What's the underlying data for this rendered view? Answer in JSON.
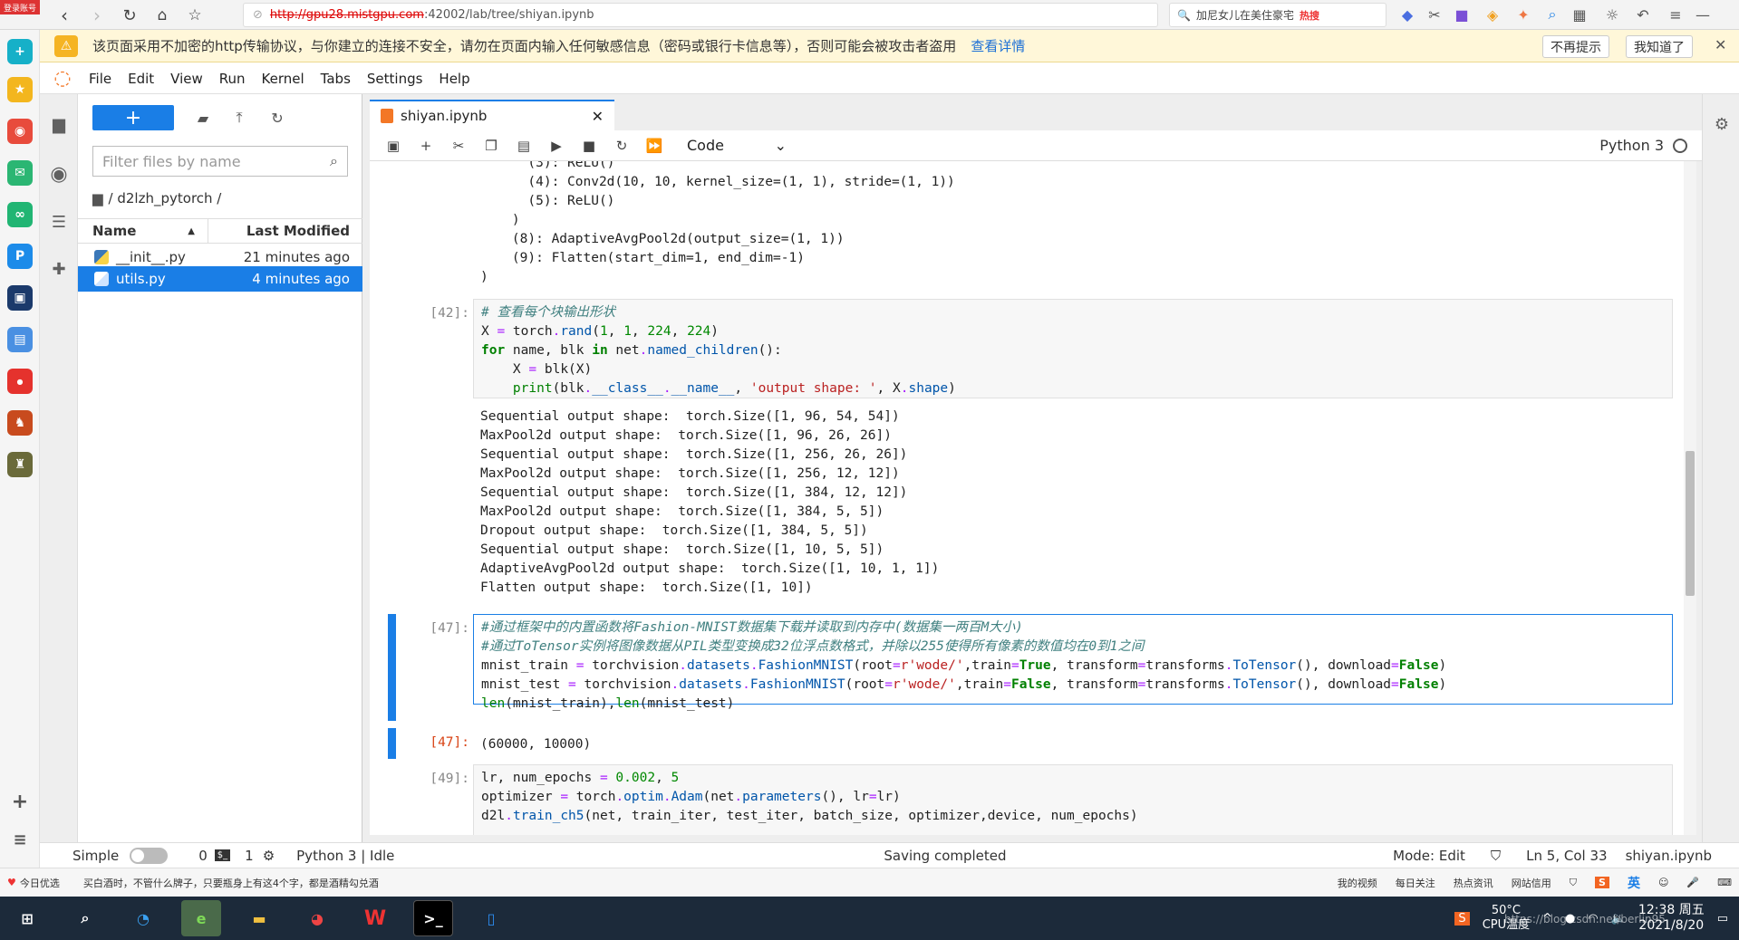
{
  "browser": {
    "login_badge": "登录账号",
    "url_host": "http://gpu28.mistgpu.com",
    "url_rest": ":42002/lab/tree/shiyan.ipynb",
    "search_text": "加尼女儿在美住豪宅",
    "search_hot": "热搜"
  },
  "warning": {
    "text": "该页面采用不加密的http传输协议，与你建立的连接不安全，请勿在页面内输入任何敏感信息（密码或银行卡信息等），否则可能会被攻击者盗用",
    "link": "查看详情",
    "btn_no_prompt": "不再提示",
    "btn_ok": "我知道了",
    "close": "✕"
  },
  "menu": [
    "File",
    "Edit",
    "View",
    "Run",
    "Kernel",
    "Tabs",
    "Settings",
    "Help"
  ],
  "file_browser": {
    "new_label": "+",
    "filter_placeholder": "Filter files by name",
    "breadcrumb": "/ d2lzh_pytorch /",
    "col_name": "Name",
    "col_modified": "Last Modified",
    "files": [
      {
        "name": "__init__.py",
        "modified": "21 minutes ago"
      },
      {
        "name": "utils.py",
        "modified": "4 minutes ago"
      }
    ]
  },
  "notebook": {
    "tab_title": "shiyan.ipynb",
    "cell_type": "Code",
    "kernel": "Python 3",
    "top_output": [
      "      (3): ReLU()",
      "      (4): Conv2d(10, 10, kernel_size=(1, 1), stride=(1, 1))",
      "      (5): ReLU()",
      "    )",
      "    (8): AdaptiveAvgPool2d(output_size=(1, 1))",
      "    (9): Flatten(start_dim=1, end_dim=-1)",
      ")"
    ],
    "cell42_prompt": "[42]:",
    "cell42_output": [
      "Sequential output shape:  torch.Size([1, 96, 54, 54])",
      "MaxPool2d output shape:  torch.Size([1, 96, 26, 26])",
      "Sequential output shape:  torch.Size([1, 256, 26, 26])",
      "MaxPool2d output shape:  torch.Size([1, 256, 12, 12])",
      "Sequential output shape:  torch.Size([1, 384, 12, 12])",
      "MaxPool2d output shape:  torch.Size([1, 384, 5, 5])",
      "Dropout output shape:  torch.Size([1, 384, 5, 5])",
      "Sequential output shape:  torch.Size([1, 10, 5, 5])",
      "AdaptiveAvgPool2d output shape:  torch.Size([1, 10, 1, 1])",
      "Flatten output shape:  torch.Size([1, 10])"
    ],
    "cell47_prompt": "[47]:",
    "cell47_out_prompt": "[47]:",
    "cell47_output": "(60000, 10000)",
    "cell49_prompt": "[49]:"
  },
  "status": {
    "simple": "Simple",
    "count0": "0",
    "count1": "1",
    "kernel_state": "Python 3 | Idle",
    "saving": "Saving completed",
    "mode": "Mode: Edit",
    "position": "Ln 5, Col 33",
    "file": "shiyan.ipynb"
  },
  "news": {
    "left1": "今日优选",
    "left2": "买白酒时，不管什么牌子，只要瓶身上有这4个字，都是酒精勾兑酒",
    "items": [
      "我的视频",
      "每日关注",
      "热点资讯",
      "网站信用"
    ],
    "ime": "英"
  },
  "taskbar": {
    "cpu_temp": "50°C",
    "cpu_label": "CPU温度",
    "time": "12:38 周五",
    "date": "2021/8/20",
    "watermark": "https://blog.csdn.net/berlin95"
  }
}
